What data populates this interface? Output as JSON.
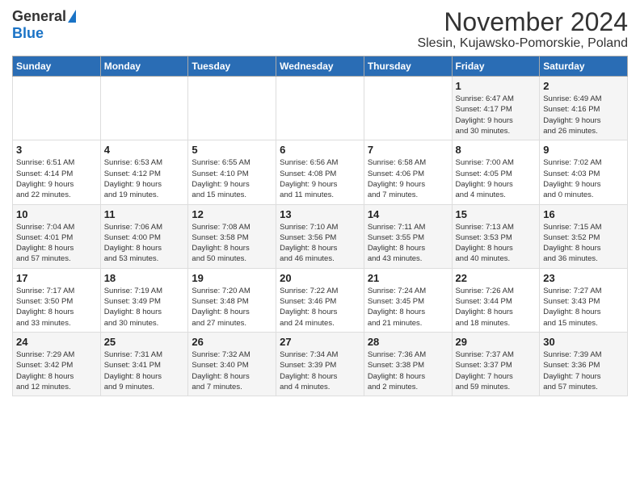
{
  "logo": {
    "general": "General",
    "blue": "Blue"
  },
  "title": "November 2024",
  "subtitle": "Slesin, Kujawsko-Pomorskie, Poland",
  "headers": [
    "Sunday",
    "Monday",
    "Tuesday",
    "Wednesday",
    "Thursday",
    "Friday",
    "Saturday"
  ],
  "weeks": [
    [
      {
        "day": "",
        "info": ""
      },
      {
        "day": "",
        "info": ""
      },
      {
        "day": "",
        "info": ""
      },
      {
        "day": "",
        "info": ""
      },
      {
        "day": "",
        "info": ""
      },
      {
        "day": "1",
        "info": "Sunrise: 6:47 AM\nSunset: 4:17 PM\nDaylight: 9 hours\nand 30 minutes."
      },
      {
        "day": "2",
        "info": "Sunrise: 6:49 AM\nSunset: 4:16 PM\nDaylight: 9 hours\nand 26 minutes."
      }
    ],
    [
      {
        "day": "3",
        "info": "Sunrise: 6:51 AM\nSunset: 4:14 PM\nDaylight: 9 hours\nand 22 minutes."
      },
      {
        "day": "4",
        "info": "Sunrise: 6:53 AM\nSunset: 4:12 PM\nDaylight: 9 hours\nand 19 minutes."
      },
      {
        "day": "5",
        "info": "Sunrise: 6:55 AM\nSunset: 4:10 PM\nDaylight: 9 hours\nand 15 minutes."
      },
      {
        "day": "6",
        "info": "Sunrise: 6:56 AM\nSunset: 4:08 PM\nDaylight: 9 hours\nand 11 minutes."
      },
      {
        "day": "7",
        "info": "Sunrise: 6:58 AM\nSunset: 4:06 PM\nDaylight: 9 hours\nand 7 minutes."
      },
      {
        "day": "8",
        "info": "Sunrise: 7:00 AM\nSunset: 4:05 PM\nDaylight: 9 hours\nand 4 minutes."
      },
      {
        "day": "9",
        "info": "Sunrise: 7:02 AM\nSunset: 4:03 PM\nDaylight: 9 hours\nand 0 minutes."
      }
    ],
    [
      {
        "day": "10",
        "info": "Sunrise: 7:04 AM\nSunset: 4:01 PM\nDaylight: 8 hours\nand 57 minutes."
      },
      {
        "day": "11",
        "info": "Sunrise: 7:06 AM\nSunset: 4:00 PM\nDaylight: 8 hours\nand 53 minutes."
      },
      {
        "day": "12",
        "info": "Sunrise: 7:08 AM\nSunset: 3:58 PM\nDaylight: 8 hours\nand 50 minutes."
      },
      {
        "day": "13",
        "info": "Sunrise: 7:10 AM\nSunset: 3:56 PM\nDaylight: 8 hours\nand 46 minutes."
      },
      {
        "day": "14",
        "info": "Sunrise: 7:11 AM\nSunset: 3:55 PM\nDaylight: 8 hours\nand 43 minutes."
      },
      {
        "day": "15",
        "info": "Sunrise: 7:13 AM\nSunset: 3:53 PM\nDaylight: 8 hours\nand 40 minutes."
      },
      {
        "day": "16",
        "info": "Sunrise: 7:15 AM\nSunset: 3:52 PM\nDaylight: 8 hours\nand 36 minutes."
      }
    ],
    [
      {
        "day": "17",
        "info": "Sunrise: 7:17 AM\nSunset: 3:50 PM\nDaylight: 8 hours\nand 33 minutes."
      },
      {
        "day": "18",
        "info": "Sunrise: 7:19 AM\nSunset: 3:49 PM\nDaylight: 8 hours\nand 30 minutes."
      },
      {
        "day": "19",
        "info": "Sunrise: 7:20 AM\nSunset: 3:48 PM\nDaylight: 8 hours\nand 27 minutes."
      },
      {
        "day": "20",
        "info": "Sunrise: 7:22 AM\nSunset: 3:46 PM\nDaylight: 8 hours\nand 24 minutes."
      },
      {
        "day": "21",
        "info": "Sunrise: 7:24 AM\nSunset: 3:45 PM\nDaylight: 8 hours\nand 21 minutes."
      },
      {
        "day": "22",
        "info": "Sunrise: 7:26 AM\nSunset: 3:44 PM\nDaylight: 8 hours\nand 18 minutes."
      },
      {
        "day": "23",
        "info": "Sunrise: 7:27 AM\nSunset: 3:43 PM\nDaylight: 8 hours\nand 15 minutes."
      }
    ],
    [
      {
        "day": "24",
        "info": "Sunrise: 7:29 AM\nSunset: 3:42 PM\nDaylight: 8 hours\nand 12 minutes."
      },
      {
        "day": "25",
        "info": "Sunrise: 7:31 AM\nSunset: 3:41 PM\nDaylight: 8 hours\nand 9 minutes."
      },
      {
        "day": "26",
        "info": "Sunrise: 7:32 AM\nSunset: 3:40 PM\nDaylight: 8 hours\nand 7 minutes."
      },
      {
        "day": "27",
        "info": "Sunrise: 7:34 AM\nSunset: 3:39 PM\nDaylight: 8 hours\nand 4 minutes."
      },
      {
        "day": "28",
        "info": "Sunrise: 7:36 AM\nSunset: 3:38 PM\nDaylight: 8 hours\nand 2 minutes."
      },
      {
        "day": "29",
        "info": "Sunrise: 7:37 AM\nSunset: 3:37 PM\nDaylight: 7 hours\nand 59 minutes."
      },
      {
        "day": "30",
        "info": "Sunrise: 7:39 AM\nSunset: 3:36 PM\nDaylight: 7 hours\nand 57 minutes."
      }
    ]
  ]
}
